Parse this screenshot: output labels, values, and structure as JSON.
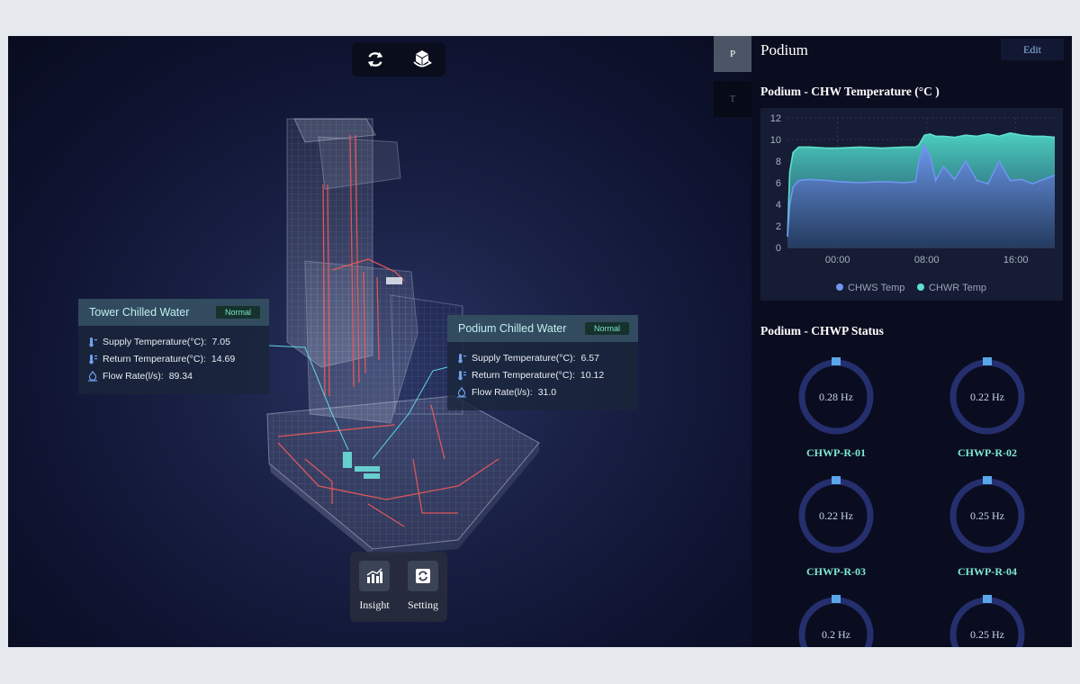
{
  "toolbar": {
    "items": [
      {
        "icon": "refresh-icon"
      },
      {
        "icon": "cube-rotate-icon"
      }
    ]
  },
  "cards": {
    "tower": {
      "title": "Tower Chilled Water",
      "status": "Normal",
      "rows": [
        {
          "icon": "thermometer-icon",
          "label": "Supply Temperature(°C):",
          "value": "7.05"
        },
        {
          "icon": "thermometer-icon",
          "label": "Return Temperature(°C):",
          "value": "14.69"
        },
        {
          "icon": "flow-icon",
          "label": "Flow Rate(l/s):",
          "value": "89.34"
        }
      ]
    },
    "podium": {
      "title": "Podium Chilled Water",
      "status": "Normal",
      "rows": [
        {
          "icon": "thermometer-icon",
          "label": "Supply Temperature(°C):",
          "value": "6.57"
        },
        {
          "icon": "thermometer-icon",
          "label": "Return Temperature(°C):",
          "value": "10.12"
        },
        {
          "icon": "flow-icon",
          "label": "Flow Rate(l/s):",
          "value": "31.0"
        }
      ]
    }
  },
  "bottom_bar": {
    "items": [
      {
        "label": "Insight",
        "icon": "chart-icon"
      },
      {
        "label": "Setting",
        "icon": "settings-icon"
      }
    ]
  },
  "side_tabs": [
    {
      "label": "P",
      "active": true
    },
    {
      "label": "T",
      "active": false
    }
  ],
  "panel": {
    "title": "Podium",
    "edit_label": "Edit",
    "chart_title": "Podium - CHW Temperature (°C )",
    "status_title": "Podium - CHWP Status",
    "pumps": [
      {
        "name": "CHWP-R-01",
        "value": "0.28 Hz"
      },
      {
        "name": "CHWP-R-02",
        "value": "0.22 Hz"
      },
      {
        "name": "CHWP-R-03",
        "value": "0.22 Hz"
      },
      {
        "name": "CHWP-R-04",
        "value": "0.25 Hz"
      },
      {
        "name": "",
        "value": "0.2 Hz"
      },
      {
        "name": "",
        "value": "0.25 Hz"
      }
    ]
  },
  "colors": {
    "chws": "#6f95f0",
    "chwr": "#5fe0cf",
    "accent": "#7de8d6",
    "gauge_ring": "#252f6e",
    "gauge_marker": "#5aa6ea"
  },
  "chart_data": {
    "type": "area",
    "title": "Podium - CHW Temperature (°C )",
    "xlabel": "",
    "ylabel": "",
    "ylim": [
      0,
      12
    ],
    "yticks": [
      0,
      2,
      4,
      6,
      8,
      10,
      12
    ],
    "xticks": [
      "00:00",
      "08:00",
      "16:00"
    ],
    "xlim": [
      -4.5,
      19.5
    ],
    "x": [
      -4.5,
      -4.3,
      -4.0,
      -3.5,
      -2.5,
      -1,
      0,
      2,
      4,
      6,
      7,
      7.3,
      7.8,
      8.3,
      8.8,
      9.5,
      10.5,
      11.5,
      12.5,
      13.5,
      14.5,
      15.5,
      16.5,
      17.5,
      18.5,
      19.5
    ],
    "series": [
      {
        "name": "CHWS Temp",
        "values": [
          1,
          4.0,
          5.6,
          6.2,
          6.3,
          6.2,
          6.1,
          6.0,
          6.1,
          6.0,
          6.1,
          8.0,
          9.5,
          8.5,
          6.2,
          7.5,
          6.3,
          8.0,
          6.2,
          5.9,
          8.0,
          6.2,
          6.3,
          5.9,
          6.3,
          6.7
        ]
      },
      {
        "name": "CHWR Temp",
        "values": [
          1,
          7.0,
          8.8,
          9.3,
          9.3,
          9.2,
          9.2,
          9.3,
          9.2,
          9.3,
          9.3,
          9.5,
          10.4,
          10.5,
          10.3,
          10.3,
          10.2,
          10.4,
          10.3,
          10.5,
          10.3,
          10.6,
          10.4,
          10.3,
          10.3,
          10.2
        ]
      }
    ],
    "legend": "bottom",
    "grid": true
  }
}
